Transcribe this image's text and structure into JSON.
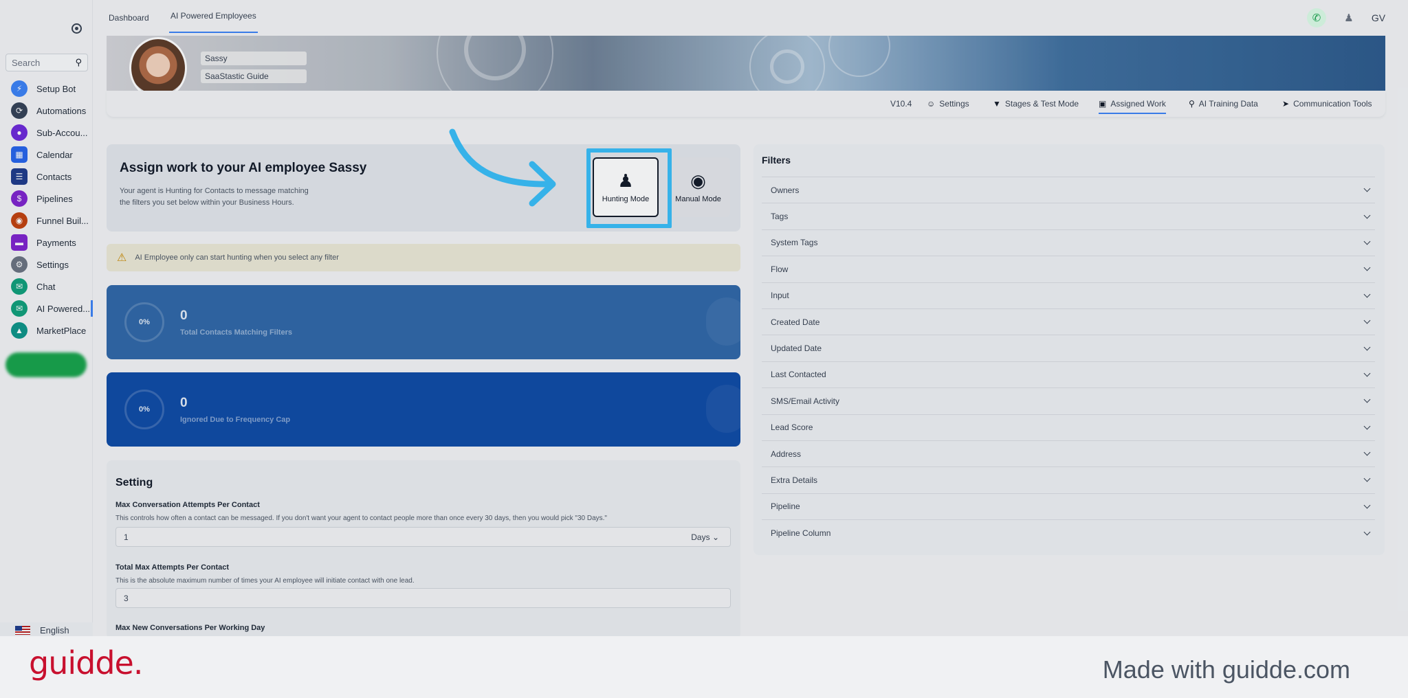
{
  "sidebar": {
    "search_placeholder": "Search",
    "items": [
      {
        "label": "Setup Bot",
        "icon": "bolt-icon",
        "color": "#3b82f6"
      },
      {
        "label": "Automations",
        "icon": "automation-icon",
        "color": "#334155"
      },
      {
        "label": "Sub-Accou...",
        "icon": "person-icon",
        "color": "#6d28d9"
      },
      {
        "label": "Calendar",
        "icon": "calendar-icon",
        "color": "#2563eb"
      },
      {
        "label": "Contacts",
        "icon": "contacts-icon",
        "color": "#1e3a8a"
      },
      {
        "label": "Pipelines",
        "icon": "dollar-icon",
        "color": "#7e22ce"
      },
      {
        "label": "Funnel Buil...",
        "icon": "funnel-icon",
        "color": "#c2410c"
      },
      {
        "label": "Payments",
        "icon": "card-icon",
        "color": "#7e22ce"
      },
      {
        "label": "Settings",
        "icon": "gear-icon",
        "color": "#6b7280"
      },
      {
        "label": "Chat",
        "icon": "chat-icon",
        "color": "#0f9f7a"
      },
      {
        "label": "AI Powered...",
        "icon": "ai-chat-icon",
        "color": "#0f9f7a"
      },
      {
        "label": "MarketPlace",
        "icon": "marketplace-icon",
        "color": "#0d9488"
      }
    ],
    "language": "English"
  },
  "topbar": {
    "tabs": [
      "Dashboard",
      "AI Powered Employees"
    ],
    "user_initials": "GV"
  },
  "banner": {
    "name": "Sassy",
    "subtitle": "SaaStastic Guide"
  },
  "subnav": {
    "version": "V10.4",
    "items": [
      "Settings",
      "Stages & Test Mode",
      "Assigned Work",
      "AI Training Data",
      "Communication Tools"
    ]
  },
  "assign": {
    "title": "Assign work to your AI employee Sassy",
    "desc_line1": "Your agent is Hunting for Contacts to message matching",
    "desc_line2": "the filters you set below within your Business Hours.",
    "hunting_label": "Hunting Mode",
    "manual_label": "Manual Mode"
  },
  "warning": "AI Employee only can start hunting when you select any filter",
  "stats": [
    {
      "percent": "0%",
      "value": "0",
      "label": "Total Contacts Matching Filters"
    },
    {
      "percent": "0%",
      "value": "0",
      "label": "Ignored Due to Frequency Cap"
    }
  ],
  "setting": {
    "title": "Setting",
    "max_conv_label": "Max Conversation Attempts Per Contact",
    "max_conv_desc": "This controls how often a contact can be messaged. If you don't want your agent to contact people more than once every 30 days, then you would pick \"30 Days.\"",
    "max_conv_value": "1",
    "max_conv_unit": "Days",
    "total_max_label": "Total Max Attempts Per Contact",
    "total_max_desc": "This is the absolute maximum number of times your AI employee will initiate contact with one lead.",
    "total_max_value": "3",
    "max_new_label": "Max New Conversations Per Working Day"
  },
  "filters": {
    "title": "Filters",
    "items": [
      "Owners",
      "Tags",
      "System Tags",
      "Flow",
      "Input",
      "Created Date",
      "Updated Date",
      "Last Contacted",
      "SMS/Email Activity",
      "Lead Score",
      "Address",
      "Extra Details",
      "Pipeline",
      "Pipeline Column"
    ]
  },
  "footer": {
    "brand": "guidde.",
    "made_with": "Made with guidde.com"
  },
  "colors": {
    "accent": "#3b82f6",
    "highlight": "#38bdf8",
    "stat1": "#2f67a8",
    "stat2": "#0e4aa5",
    "brand": "#c8102e"
  }
}
